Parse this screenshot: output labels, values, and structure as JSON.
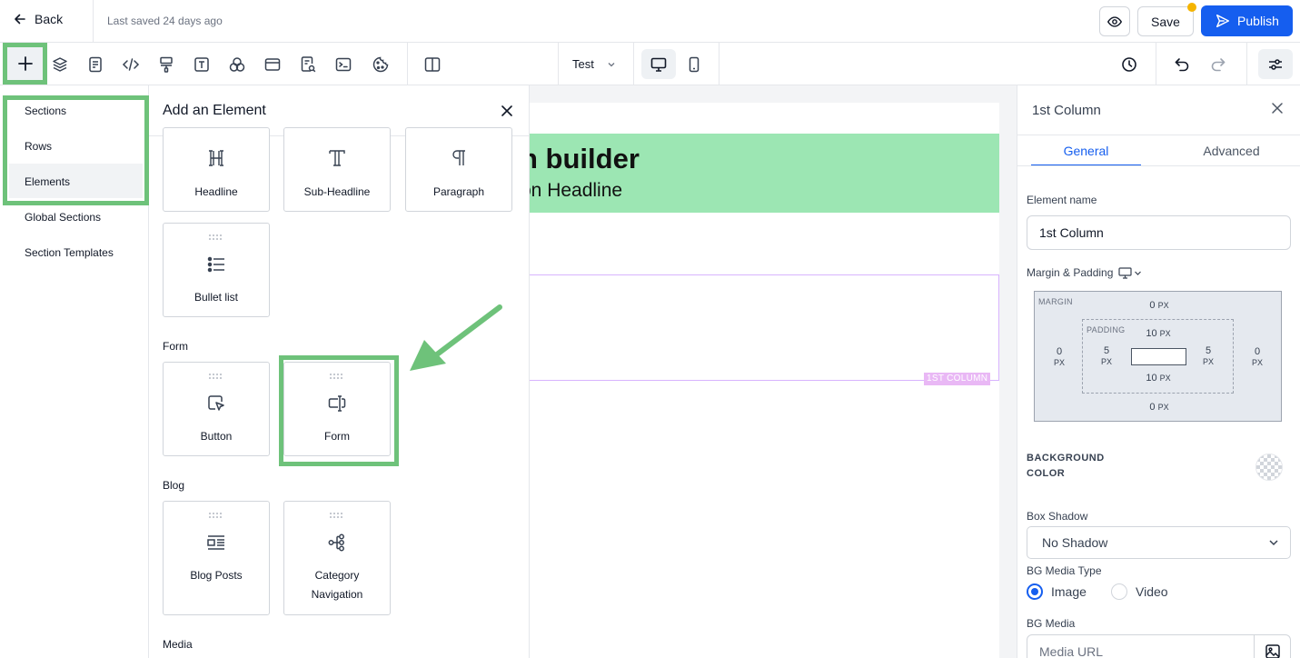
{
  "topbar": {
    "back_label": "Back",
    "last_saved": "Last saved 24 days ago",
    "save_label": "Save",
    "publish_label": "Publish"
  },
  "toolbar": {
    "test_select_value": "Test",
    "icons": [
      "plus-icon",
      "layers-icon",
      "page-icon",
      "code-icon",
      "paint-roller-icon",
      "text-box-icon",
      "shapes-icon",
      "layout-icon",
      "search-doc-icon",
      "terminal-icon",
      "cookie-icon",
      "columns-icon",
      "desktop-icon",
      "mobile-icon",
      "history-icon",
      "undo-icon",
      "redo-icon",
      "sliders-icon"
    ]
  },
  "leftnav": {
    "items": [
      {
        "label": "Sections"
      },
      {
        "label": "Rows"
      },
      {
        "label": "Elements"
      },
      {
        "label": "Global Sections"
      },
      {
        "label": "Section Templates"
      }
    ],
    "active": "Elements"
  },
  "element_panel": {
    "title": "Add an Element",
    "text_cards": [
      {
        "label": "Headline",
        "icon": "headline-icon"
      },
      {
        "label": "Sub-Headline",
        "icon": "sub-headline-icon"
      },
      {
        "label": "Paragraph",
        "icon": "paragraph-icon"
      },
      {
        "label": "Bullet list",
        "icon": "bullet-list-icon"
      }
    ],
    "form_category": "Form",
    "form_cards": [
      {
        "label": "Button",
        "icon": "button-cursor-icon"
      },
      {
        "label": "Form",
        "icon": "form-icon"
      }
    ],
    "blog_category": "Blog",
    "blog_cards": [
      {
        "label": "Blog Posts",
        "icon": "blog-posts-icon"
      },
      {
        "label": "Category",
        "label2": "Navigation",
        "icon": "category-navigation-icon"
      }
    ],
    "media_category": "Media"
  },
  "canvas": {
    "hero_title": "n builder",
    "hero_subtitle": "on Headline",
    "column_badge": "1ST COLUMN",
    "hero_color": "#9ce6b3"
  },
  "right_panel": {
    "title": "1st Column",
    "tabs": {
      "general": "General",
      "advanced": "Advanced"
    },
    "element_name_label": "Element name",
    "element_name_value": "1st Column",
    "margin_padding_label": "Margin & Padding",
    "margin": {
      "caption": "MARGIN",
      "top": "0",
      "bottom": "0",
      "left": "0",
      "right": "0",
      "unit": "PX"
    },
    "padding": {
      "caption": "PADDING",
      "top": "10",
      "bottom": "10",
      "left": "5",
      "right": "5",
      "unit": "PX"
    },
    "bg_color_label_1": "BACKGROUND",
    "bg_color_label_2": "COLOR",
    "box_shadow_label": "Box Shadow",
    "box_shadow_value": "No Shadow",
    "bg_media_type_label": "BG Media Type",
    "media_type_options": {
      "image": "Image",
      "video": "Video"
    },
    "media_type_selected": "Image",
    "bg_media_label": "BG Media",
    "media_url_placeholder": "Media URL"
  },
  "colors": {
    "accent": "#155eef",
    "highlight": "#6ec27a",
    "badge": "#e9b8f5",
    "notification_dot": "#f5b400"
  }
}
